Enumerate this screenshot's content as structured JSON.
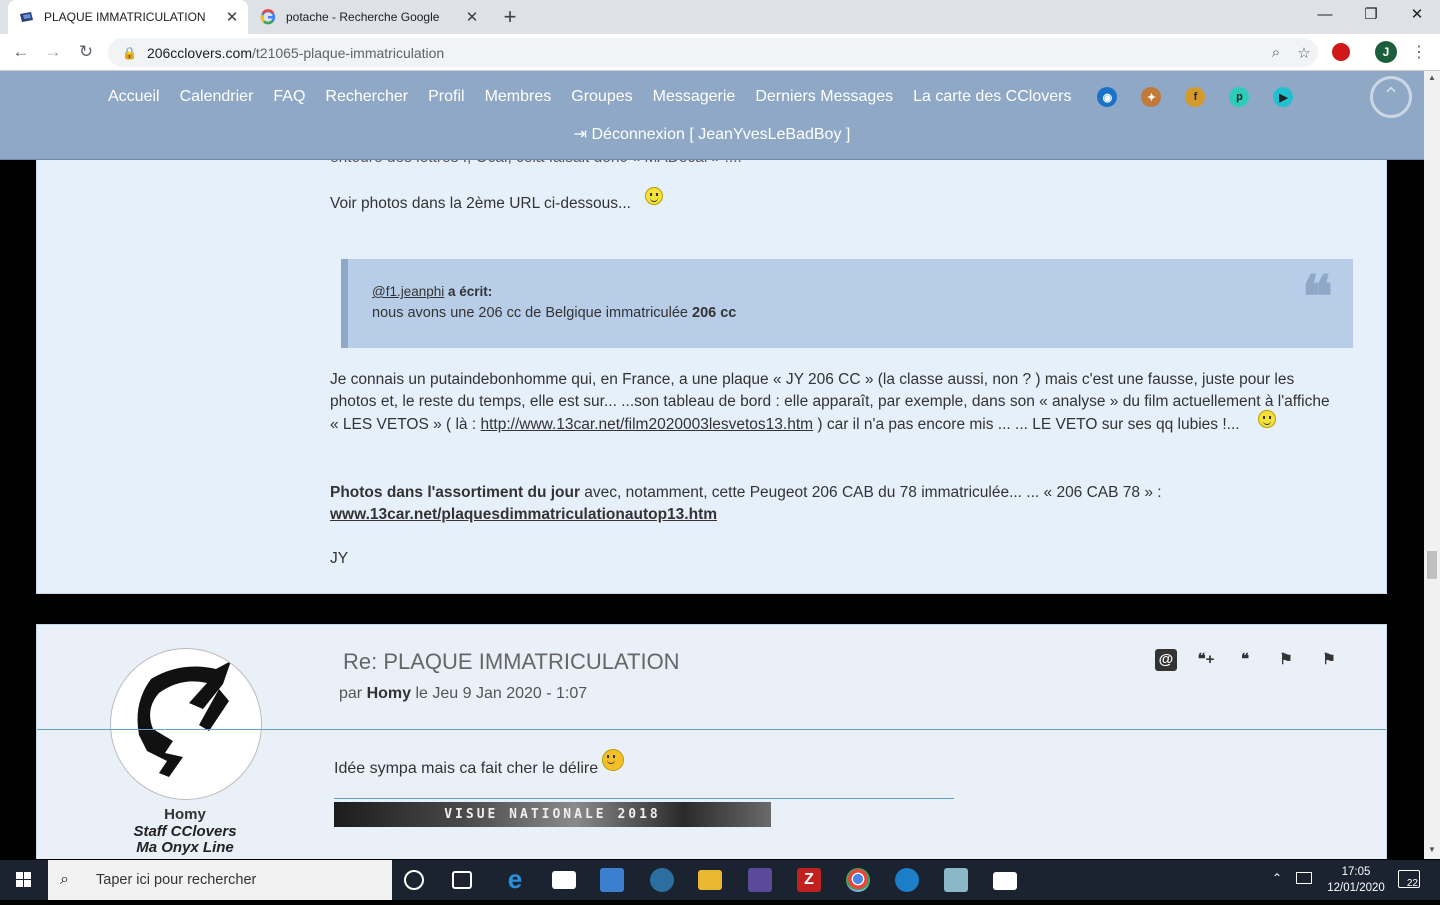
{
  "browser": {
    "tabs": [
      {
        "title": "PLAQUE IMMATRICULATION",
        "active": true
      },
      {
        "title": "potache - Recherche Google",
        "active": false
      }
    ],
    "url_host": "206cclovers.com",
    "url_path": "/t21065-plaque-immatriculation",
    "profile_initial": "J"
  },
  "nav": {
    "links": [
      "Accueil",
      "Calendrier",
      "FAQ",
      "Rechercher",
      "Profil",
      "Membres",
      "Groupes",
      "Messagerie",
      "Derniers Messages",
      "La carte des CClovers"
    ],
    "social_icons": [
      "wifi-icon",
      "twitter-icon",
      "facebook-icon",
      "pinterest-icon",
      "youtube-icon"
    ],
    "logout": "Déconnexion [ JeanYvesLeBadBoy ]"
  },
  "post1": {
    "cut_line": "entoure des lettres I, Ocal, cela faisait donc « MADocal » !...",
    "voir_photos": "Voir photos dans la 2ème URL ci-dessous...",
    "quote": {
      "author": "@f1.jeanphi",
      "wrote": " a écrit:",
      "text_before": "nous avons une 206 cc de Belgique immatriculée ",
      "text_bold": "206 cc"
    },
    "para1_line1": "Je connais un putaindebonhomme qui, en France, a une plaque « JY 206 CC » (la classe aussi, non ? ) mais c'est une fausse, juste pour les",
    "para1_line2": "photos et, le reste du temps, elle est sur... ...son tableau de bord : elle apparaît, par exemple, dans son « analyse » du film actuellement à l'affiche",
    "para1_line3_a": "« LES VETOS » ( là : ",
    "para1_link": "http://www.13car.net/film2020003lesvetos13.htm",
    "para1_line3_b": " )  car il n'a pas encore mis ... ... LE VETO sur ses qq lubies !...",
    "para2_bold": "Photos dans l'assortiment du jour",
    "para2_rest": " avec, notamment, cette Peugeot 206 CAB du 78 immatriculée... ... « 206 CAB 78 » :",
    "para2_link": "www.13car.net/plaquesdimmatriculationautop13.htm",
    "signoff": "JY"
  },
  "post2": {
    "title": "Re: PLAQUE IMMATRICULATION",
    "meta_par": "par ",
    "meta_author": "Homy",
    "meta_date": " le Jeu 9 Jan 2020 - 1:07",
    "text": "Idée sympa mais ca fait cher le délire",
    "signature_banner": "VISUE NATIONALE 2018",
    "user": {
      "name": "Homy",
      "rank1": "Staff CClovers",
      "rank2": "Ma Onyx Line"
    },
    "action_icons": [
      "mention-icon",
      "multiquote-icon",
      "quote-icon",
      "report-icon",
      "moderate-icon"
    ]
  },
  "taskbar": {
    "search_placeholder": "Taper ici pour rechercher",
    "time": "17:05",
    "date": "12/01/2020",
    "notifications": "22"
  },
  "colors": {
    "nav_bg": "#8ea8c6",
    "post_bg": "#e6f0fb",
    "quote_bg": "#b7cde8",
    "separator": "#5fa3cf"
  }
}
